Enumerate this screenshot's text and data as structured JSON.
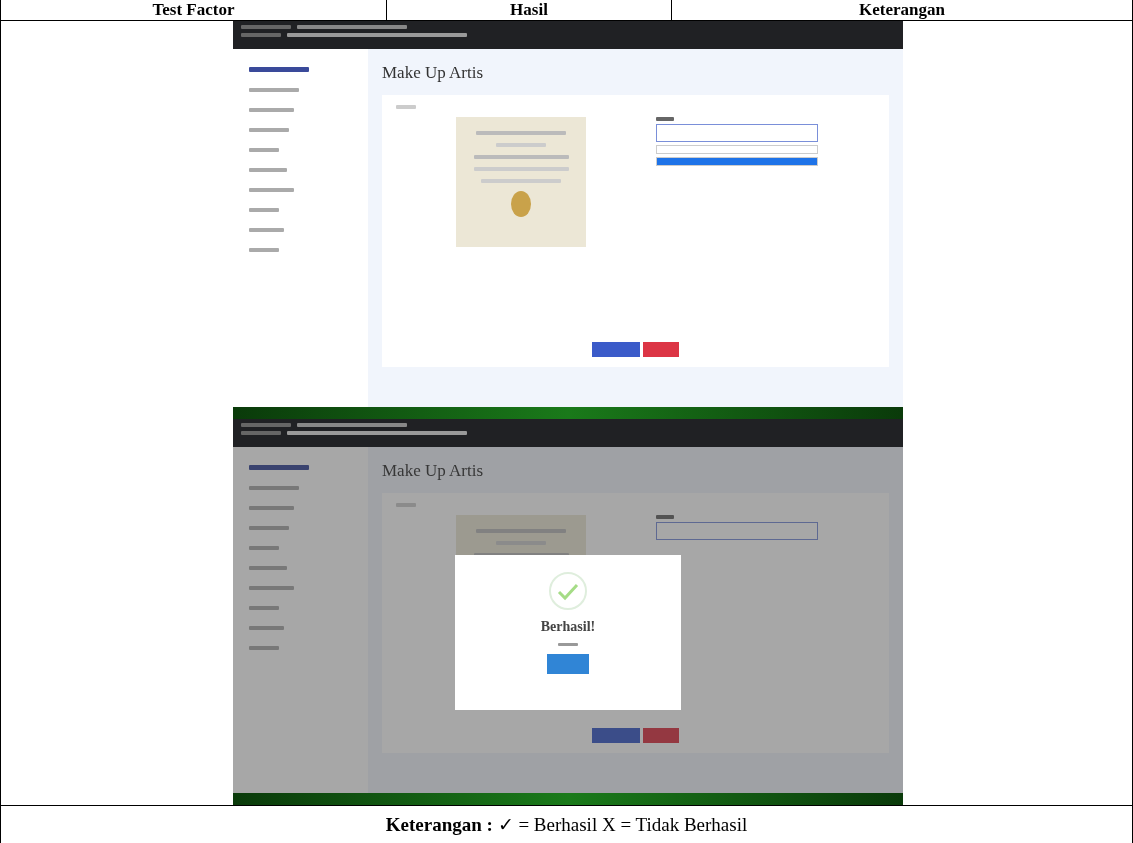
{
  "table": {
    "columns": [
      "Test Factor",
      "Hasil",
      "Keterangan"
    ],
    "screenshots": [
      {
        "kind": "select",
        "page_title": "Make Up Artis"
      },
      {
        "kind": "success-dialog",
        "page_title": "Make Up Artis",
        "dialog_title": "Berhasil!"
      }
    ],
    "footer": "**Keterangan :** ✓ = Berhasil X = Tidak Berhasil"
  }
}
